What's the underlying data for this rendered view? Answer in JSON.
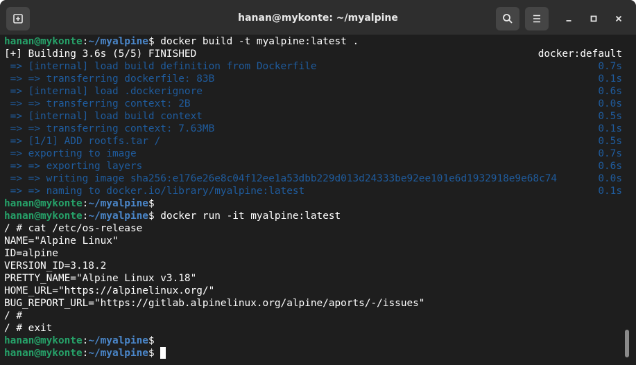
{
  "window": {
    "title": "hanan@mykonte: ~/myalpine"
  },
  "prompt": {
    "user": "hanan@mykonte",
    "sep": ":",
    "path": "~/myalpine",
    "sign": "$"
  },
  "build": {
    "command": " docker build -t myalpine:latest .",
    "status": "[+] Building 3.6s (5/5) FINISHED",
    "context": "docker:default",
    "steps": [
      {
        "text": " => [internal] load build definition from Dockerfile",
        "time": "0.7s"
      },
      {
        "text": " => => transferring dockerfile: 83B",
        "time": "0.1s"
      },
      {
        "text": " => [internal] load .dockerignore",
        "time": "0.6s"
      },
      {
        "text": " => => transferring context: 2B",
        "time": "0.0s"
      },
      {
        "text": " => [internal] load build context",
        "time": "0.5s"
      },
      {
        "text": " => => transferring context: 7.63MB",
        "time": "0.1s"
      },
      {
        "text": " => [1/1] ADD rootfs.tar /",
        "time": "0.5s"
      },
      {
        "text": " => exporting to image",
        "time": "0.7s"
      },
      {
        "text": " => => exporting layers",
        "time": "0.6s"
      },
      {
        "text": " => => writing image sha256:e176e26e8c04f12ee1a53dbb229d013d24333be92ee101e6d1932918e9e68c74",
        "time": "0.0s"
      },
      {
        "text": " => => naming to docker.io/library/myalpine:latest",
        "time": "0.1s"
      }
    ]
  },
  "run": {
    "command": " docker run -it myalpine:latest",
    "output": [
      "/ # cat /etc/os-release",
      "NAME=\"Alpine Linux\"",
      "ID=alpine",
      "VERSION_ID=3.18.2",
      "PRETTY_NAME=\"Alpine Linux v3.18\"",
      "HOME_URL=\"https://alpinelinux.org/\"",
      "BUG_REPORT_URL=\"https://gitlab.alpinelinux.org/alpine/aports/-/issues\"",
      "/ #",
      "/ # exit"
    ]
  },
  "colors": {
    "user": "#26a269",
    "path": "#4a86c9",
    "dim": "#1f5c9e",
    "background": "#1e1e1e",
    "titlebar": "#2e2e2e"
  },
  "icons": {
    "new_tab": "new-tab-icon",
    "search": "search-icon",
    "menu": "hamburger-menu-icon",
    "minimize": "minimize-icon",
    "maximize": "maximize-icon",
    "close": "close-icon"
  }
}
